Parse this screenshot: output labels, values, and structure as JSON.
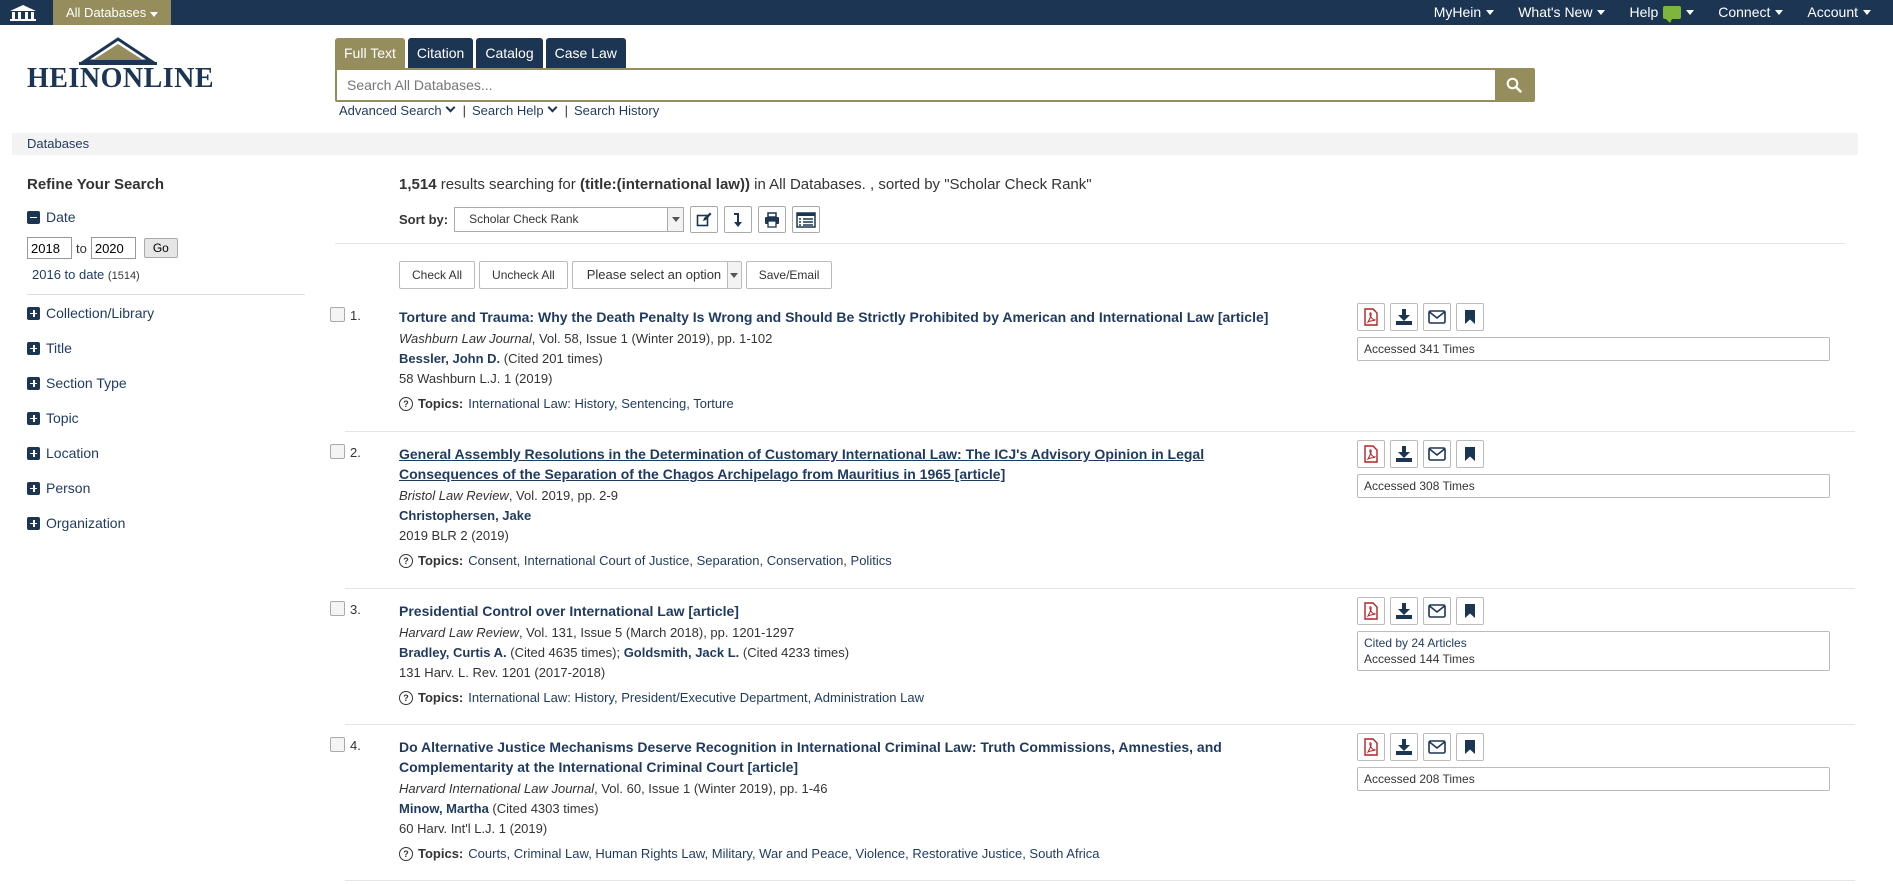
{
  "topbar": {
    "databases_label": "All Databases",
    "nav": [
      "MyHein",
      "What's New",
      "Help",
      "Connect",
      "Account"
    ]
  },
  "logo": {
    "text": "HEINONLINE"
  },
  "search": {
    "tabs": [
      "Full Text",
      "Citation",
      "Catalog",
      "Case Law"
    ],
    "placeholder": "Search All Databases...",
    "advanced": "Advanced Search",
    "help": "Search Help",
    "history": "Search History",
    "sep": "|"
  },
  "breadcrumb": "Databases",
  "sidebar": {
    "title": "Refine Your Search",
    "date": {
      "label": "Date",
      "from": "2018",
      "to_label": "to",
      "to": "2020",
      "go": "Go",
      "range_label": "2016 to date",
      "range_count": "(1514)"
    },
    "facets": [
      "Collection/Library",
      "Title",
      "Section Type",
      "Topic",
      "Location",
      "Person",
      "Organization"
    ]
  },
  "results_header": {
    "count": "1,514",
    "text1": " results searching for ",
    "query": "(title:(international law))",
    "text2": " in All Databases. , sorted by \"Scholar Check Rank\""
  },
  "sort": {
    "label": "Sort by:",
    "value": "Scholar Check Rank"
  },
  "actions": {
    "check_all": "Check All",
    "uncheck_all": "Uncheck All",
    "select": "Please select an option",
    "save_email": "Save/Email"
  },
  "topics_label": "Topics:",
  "results": [
    {
      "num": "1.",
      "title": "Torture and Trauma: Why the Death Penalty Is Wrong and Should Be Strictly Prohibited by American and International Law [article]",
      "journal": "Washburn Law Journal",
      "journal_rest": ", Vol. 58, Issue 1 (Winter 2019), pp. 1-102",
      "author": "Bessler, John D.",
      "author_rest": " (Cited 201 times)",
      "citation": "58 Washburn L.J. 1 (2019)",
      "topics": "International Law: History, Sentencing, Torture",
      "accessed": "Accessed 341 Times"
    },
    {
      "num": "2.",
      "title": "General Assembly Resolutions in the Determination of Customary International Law: The ICJ's Advisory Opinion in Legal Consequences of the Separation of the Chagos Archipelago from Mauritius in 1965 [article]",
      "journal": "Bristol Law Review",
      "journal_rest": ", Vol. 2019, pp. 2-9",
      "author": "Christophersen, Jake",
      "author_rest": "",
      "citation": "2019 BLR 2 (2019)",
      "topics": "Consent, International Court of Justice, Separation, Conservation, Politics",
      "accessed": "Accessed 308 Times"
    },
    {
      "num": "3.",
      "title": "Presidential Control over International Law [article]",
      "journal": "Harvard Law Review",
      "journal_rest": ", Vol. 131, Issue 5 (March 2018), pp. 1201-1297",
      "author": "Bradley, Curtis A.",
      "author_rest": " (Cited 4635 times); ",
      "author2": "Goldsmith, Jack L.",
      "author2_rest": " (Cited 4233 times)",
      "citation": "131 Harv. L. Rev. 1201 (2017-2018)",
      "topics": "International Law: History, President/Executive Department, Administration Law",
      "cited": "Cited by 24 Articles",
      "accessed": "Accessed 144 Times"
    },
    {
      "num": "4.",
      "title": "Do Alternative Justice Mechanisms Deserve Recognition in International Criminal Law: Truth Commissions, Amnesties, and Complementarity at the International Criminal Court [article]",
      "journal": "Harvard International Law Journal",
      "journal_rest": ", Vol. 60, Issue 1 (Winter 2019), pp. 1-46",
      "author": "Minow, Martha",
      "author_rest": " (Cited 4303 times)",
      "citation": "60 Harv. Int'l L.J. 1 (2019)",
      "topics": "Courts, Criminal Law, Human Rights Law, Military, War and Peace, Violence, Restorative Justice, South Africa",
      "accessed": "Accessed 208 Times"
    }
  ],
  "colors": {
    "navy": "#1b3552",
    "gold": "#958d5c",
    "pdf_red": "#b22222"
  }
}
